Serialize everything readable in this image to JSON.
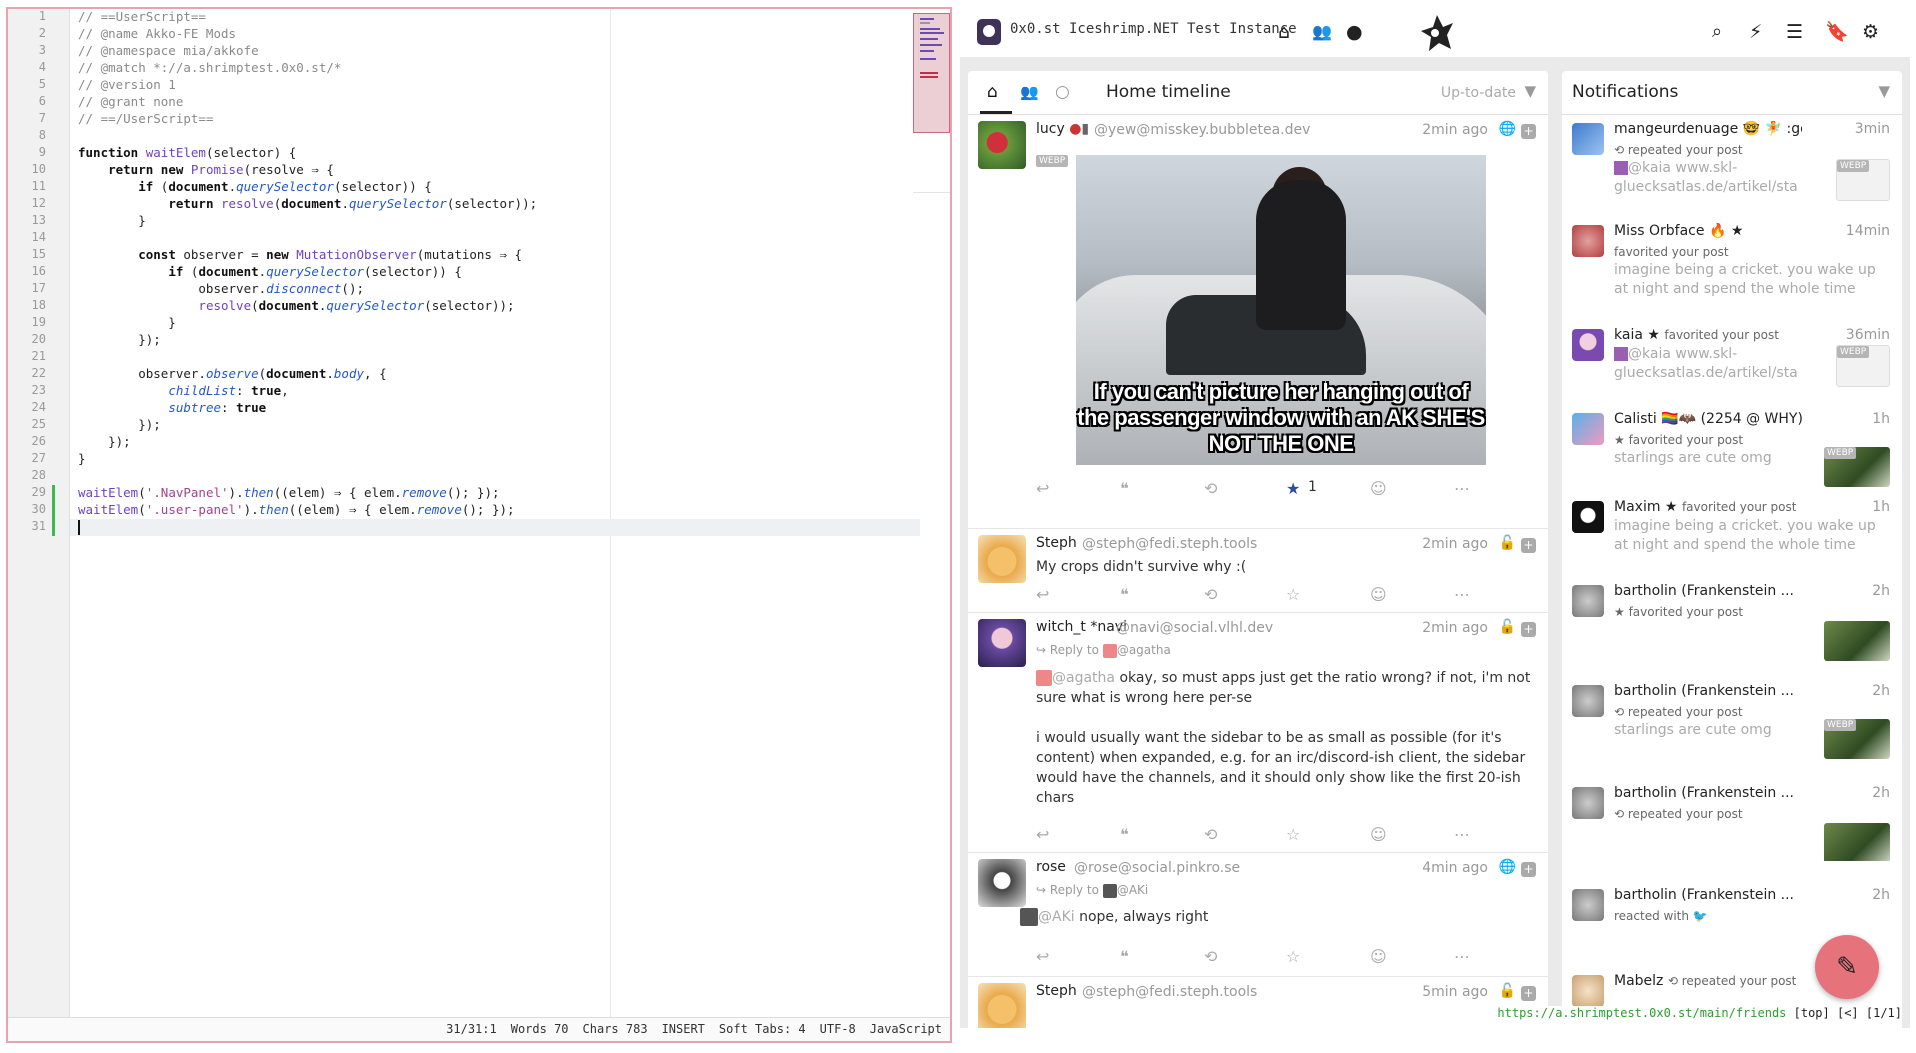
{
  "editor": {
    "lines": [
      "// ==UserScript==",
      "// @name Akko-FE Mods",
      "// @namespace mia/akkofe",
      "// @match *://a.shrimptest.0x0.st/*",
      "// @version 1",
      "// @grant none",
      "// ==/UserScript==",
      "",
      "function waitElem(selector) {",
      "    return new Promise(resolve => {",
      "        if (document.querySelector(selector)) {",
      "            return resolve(document.querySelector(selector));",
      "        }",
      "",
      "        const observer = new MutationObserver(mutations => {",
      "            if (document.querySelector(selector)) {",
      "                observer.disconnect();",
      "                resolve(document.querySelector(selector));",
      "            }",
      "        });",
      "",
      "        observer.observe(document.body, {",
      "            childList: true,",
      "            subtree: true",
      "        });",
      "    });",
      "}",
      "",
      "waitElem('.NavPanel').then((elem) => { elem.remove(); });",
      "waitElem('.user-panel').then((elem) => { elem.remove(); });",
      ""
    ],
    "status": {
      "position": "31/31:1",
      "words": "Words 70",
      "chars": "Chars 783",
      "mode": "INSERT",
      "tabs": "Soft Tabs: 4",
      "encoding": "UTF-8",
      "language": "JavaScript"
    }
  },
  "nav": {
    "instance": "0x0.st Iceshrimp.NET Test Instance",
    "icons": [
      "home-icon",
      "people-icon",
      "circle-icon",
      "search-icon",
      "bolt-icon",
      "list-icon",
      "bookmark-icon",
      "gear-icon"
    ]
  },
  "timeline": {
    "title": "Home timeline",
    "status_text": "Up-to-date",
    "posts": [
      {
        "name": "lucy",
        "handle": "@yew@misskey.bubbletea.dev",
        "time": "2min ago",
        "badge": "WEBP",
        "caption": "If you can't picture her hanging out of the passenger window with an AK  SHE'S NOT THE ONE",
        "favs": "1"
      },
      {
        "name": "Steph",
        "handle": "@steph@fedi.steph.tools",
        "time": "2min ago",
        "text": "My crops didn't survive why :("
      },
      {
        "name": "witch_t *navi",
        "handle": "@navi@social.vlhl.dev",
        "time": "2min ago",
        "reply_label": "Reply to",
        "reply_to": "@agatha",
        "mention": "@agatha",
        "text1": " okay, so must apps just get the ratio wrong? if not, i'm not sure what is wrong here per-se",
        "text2": "i would usually want the sidebar to be as small as possible (for it's content) when expanded, e.g. for an irc/discord-ish client, the sidebar would have the channels, and it should only show like the first 20-ish chars"
      },
      {
        "name": "rose",
        "handle": "@rose@social.pinkro.se",
        "time": "4min ago",
        "reply_label": "Reply to",
        "reply_to": "@AKi",
        "mention": "@AKi",
        "text": " nope, always right"
      },
      {
        "name": "Steph",
        "handle": "@steph@fedi.steph.tools",
        "time": "5min ago"
      }
    ]
  },
  "notifications": {
    "title": "Notifications",
    "items": [
      {
        "name": "mangeurdenuage 🤓 🧚 :go...",
        "time": "3min",
        "action": "repeated your post",
        "preview_user": "@kaia",
        "preview": "www.skl-gluecksatlas.de/artikel/sta",
        "thumb_badge": "WEBP"
      },
      {
        "name": "Miss Orbface 🔥 ★",
        "time": "14min",
        "action": "favorited your post",
        "preview": "imagine being a cricket. you wake up at night and spend the whole time"
      },
      {
        "name": "kaia ★",
        "inline_action": "favorited your post",
        "time": "36min",
        "preview_user": "@kaia",
        "preview": "www.skl-gluecksatlas.de/artikel/sta",
        "thumb_badge": "WEBP"
      },
      {
        "name": "Calisti 🏳️‍🌈🦇 (2254 @ WHY)",
        "time": "1h",
        "action": "★ favorited your post",
        "preview": "starlings are cute omg",
        "thumb_badge": "WEBP"
      },
      {
        "name": "Maxim ★",
        "inline_action": "favorited your post",
        "time": "1h",
        "preview": "imagine being a cricket. you wake up at night and spend the whole time"
      },
      {
        "name": "bartholin (Frankenstein ...",
        "time": "2h",
        "action": "★ favorited your post"
      },
      {
        "name": "bartholin (Frankenstein ...",
        "time": "2h",
        "action": "repeated your post",
        "preview": "starlings are cute omg",
        "thumb_badge": "WEBP"
      },
      {
        "name": "bartholin (Frankenstein ...",
        "time": "2h",
        "action": "repeated your post"
      },
      {
        "name": "bartholin (Frankenstein ...",
        "time": "2h",
        "action": "reacted with 🐦"
      },
      {
        "name": "Mabelz",
        "inline_action": "repeated your post"
      }
    ]
  },
  "url_bar": {
    "url": "https://a.shrimptest.0x0.st/main/friends",
    "extra": "[top] [<] [1/1]"
  }
}
